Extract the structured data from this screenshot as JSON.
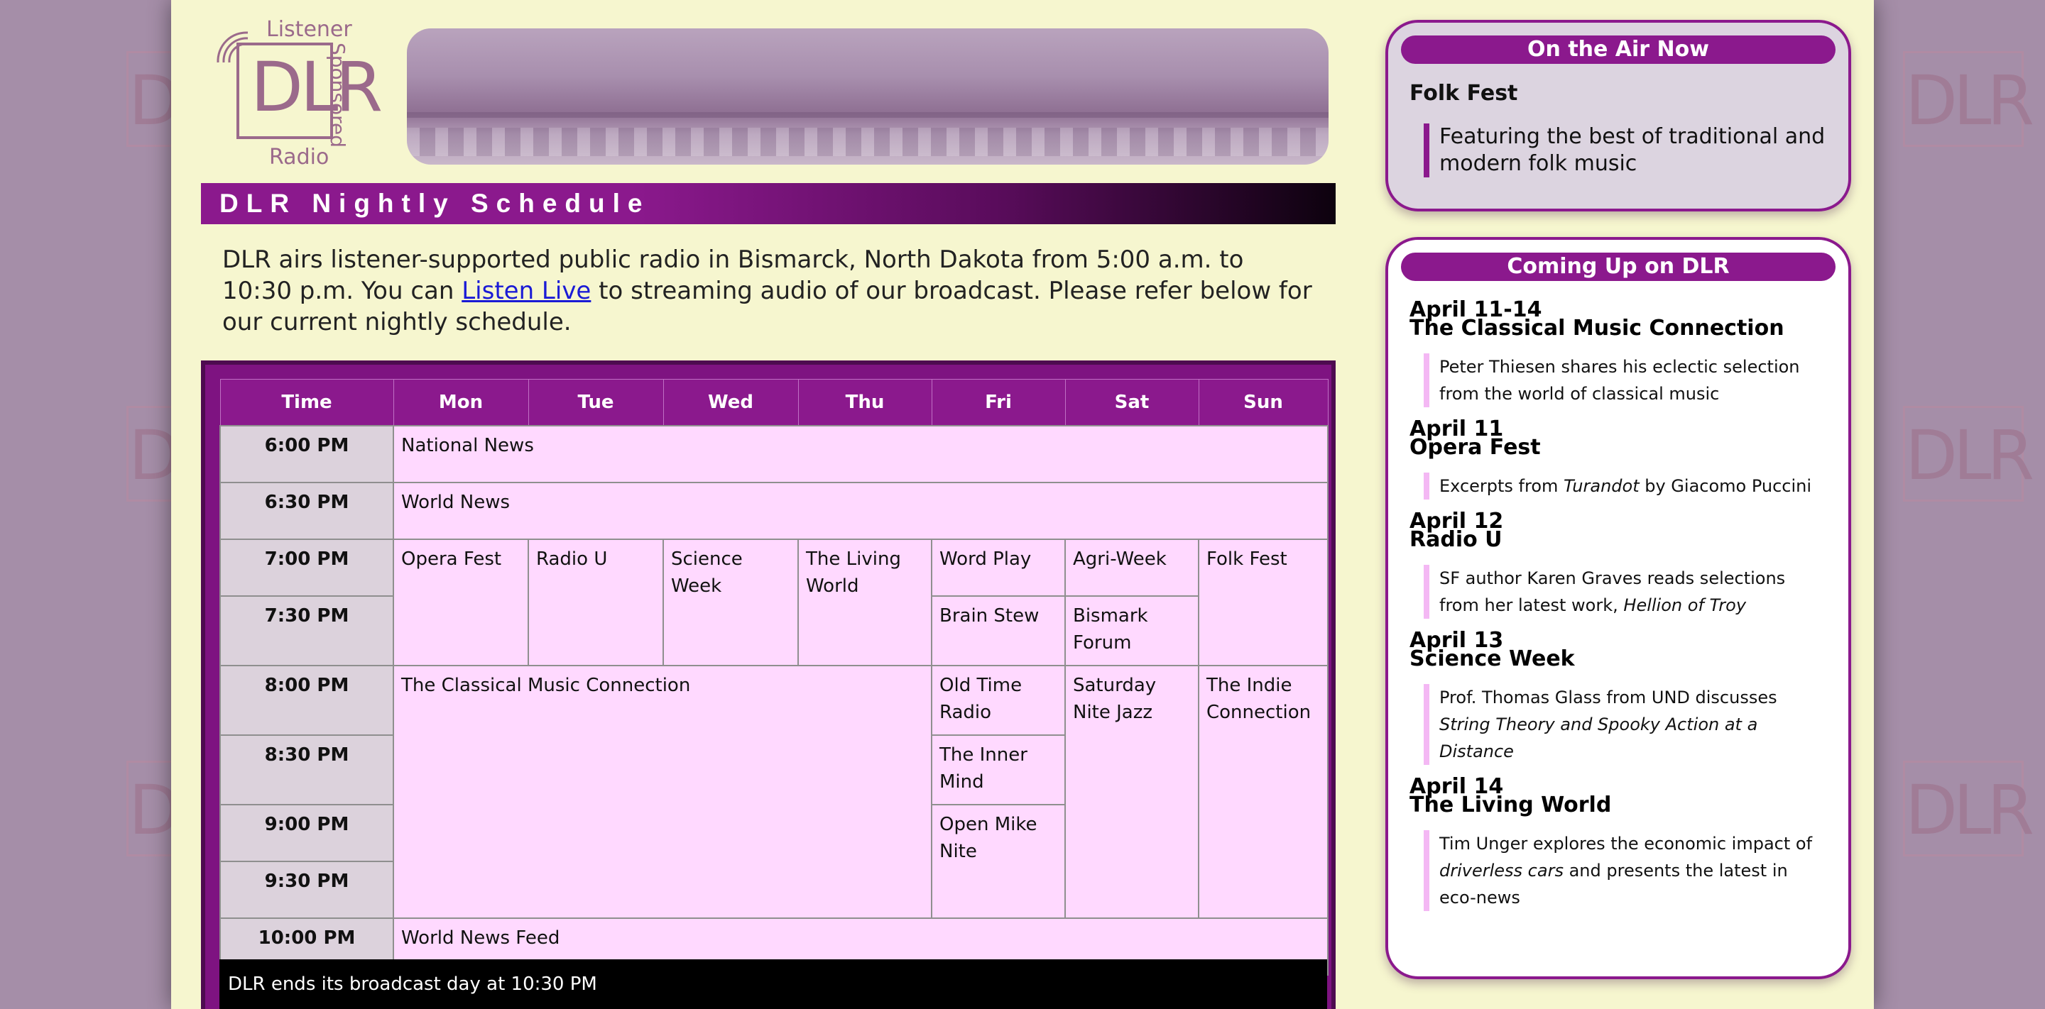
{
  "header": {
    "logo": {
      "top": "Listener",
      "side": "Sponsored",
      "main": "DLR",
      "bottom": "Radio"
    },
    "page_title": "DLR Nightly Schedule"
  },
  "intro": {
    "before_link": "DLR airs listener-supported public radio in Bismarck, North Dakota from 5:00 a.m. to 10:30 p.m. You can ",
    "link": "Listen Live",
    "after_link": " to streaming audio of our broadcast. Please refer below for our current nightly schedule."
  },
  "schedule": {
    "headers": [
      "Time",
      "Mon",
      "Tue",
      "Wed",
      "Thu",
      "Fri",
      "Sat",
      "Sun"
    ],
    "times": [
      "6:00 PM",
      "6:30 PM",
      "7:00 PM",
      "7:30 PM",
      "8:00 PM",
      "8:30 PM",
      "9:00 PM",
      "9:30 PM",
      "10:00 PM"
    ],
    "programs": {
      "national_news": "National News",
      "world_news": "World News",
      "opera_fest": "Opera Fest",
      "radio_u": "Radio U",
      "science_week": "Science Week",
      "living_world": "The Living World",
      "word_play": "Word Play",
      "agri_week": "Agri-Week",
      "folk_fest": "Folk Fest",
      "brain_stew": "Brain Stew",
      "bismark_forum": "Bismark Forum",
      "classical": "The Classical Music Connection",
      "old_time_radio": "Old Time Radio",
      "saturday_jazz": "Saturday Nite Jazz",
      "indie": "The Indie Connection",
      "inner_mind": "The Inner Mind",
      "open_mike": "Open Mike Nite",
      "world_news_feed": "World News Feed"
    },
    "footer": "DLR ends its broadcast day at 10:30 PM"
  },
  "on_air": {
    "heading": "On the Air Now",
    "show": "Folk Fest",
    "description": "Featuring the best of traditional and modern folk music"
  },
  "coming_up": {
    "heading": "Coming Up on DLR",
    "items": [
      {
        "date": "April 11-14",
        "title": "The Classical Music Connection",
        "desc": "Peter Thiesen shares his eclectic selection from the world of classical music"
      },
      {
        "date": "April 11",
        "title": "Opera Fest",
        "desc_pre": "Excerpts from ",
        "desc_em": "Turandot",
        "desc_post": " by Giacomo Puccini"
      },
      {
        "date": "April 12",
        "title": "Radio U",
        "desc_pre": "SF author Karen Graves reads selections from her latest work, ",
        "desc_em": "Hellion of Troy",
        "desc_post": ""
      },
      {
        "date": "April 13",
        "title": "Science Week",
        "desc_pre": "Prof. Thomas Glass from UND discusses ",
        "desc_em": "String Theory and Spooky Action at a Distance",
        "desc_post": ""
      },
      {
        "date": "April 14",
        "title": "The Living World",
        "desc_pre": "Tim Unger explores the economic impact of ",
        "desc_em": "driverless cars",
        "desc_post": " and presents the latest in eco-news"
      }
    ]
  },
  "background_logo": "DLR",
  "colors": {
    "accent": "#8b198d",
    "cell": "#ffd9ff",
    "time_cell": "#dcd2dc",
    "page": "#f6f6cf"
  }
}
